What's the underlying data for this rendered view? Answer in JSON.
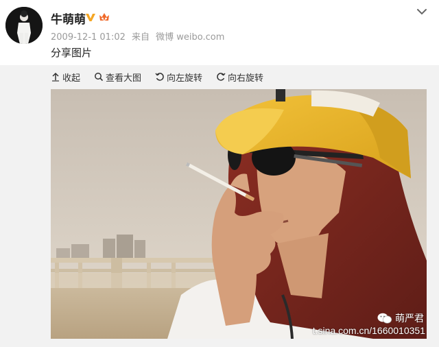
{
  "post": {
    "username": "牛萌萌",
    "timestamp": "2009-12-1 01:02",
    "source_prefix": "来自",
    "source": "微博 weibo.com",
    "text": "分享图片"
  },
  "toolbar": {
    "collapse_label": "收起",
    "view_large_label": "查看大图",
    "rotate_left_label": "向左旋转",
    "rotate_right_label": "向右旋转"
  },
  "watermark": {
    "account_name": "萌严君",
    "url": "t.sina.com.cn/1660010351"
  },
  "icons": {
    "verified": "verified-v-icon",
    "vip": "crown-icon",
    "menu": "chevron-down-icon",
    "collapse": "arrow-up-icon",
    "view": "search-icon",
    "rotate_left": "rotate-left-icon",
    "rotate_right": "rotate-right-icon"
  },
  "colors": {
    "verified_badge": "#f5a623",
    "panel_bg": "#f2f2f2"
  }
}
